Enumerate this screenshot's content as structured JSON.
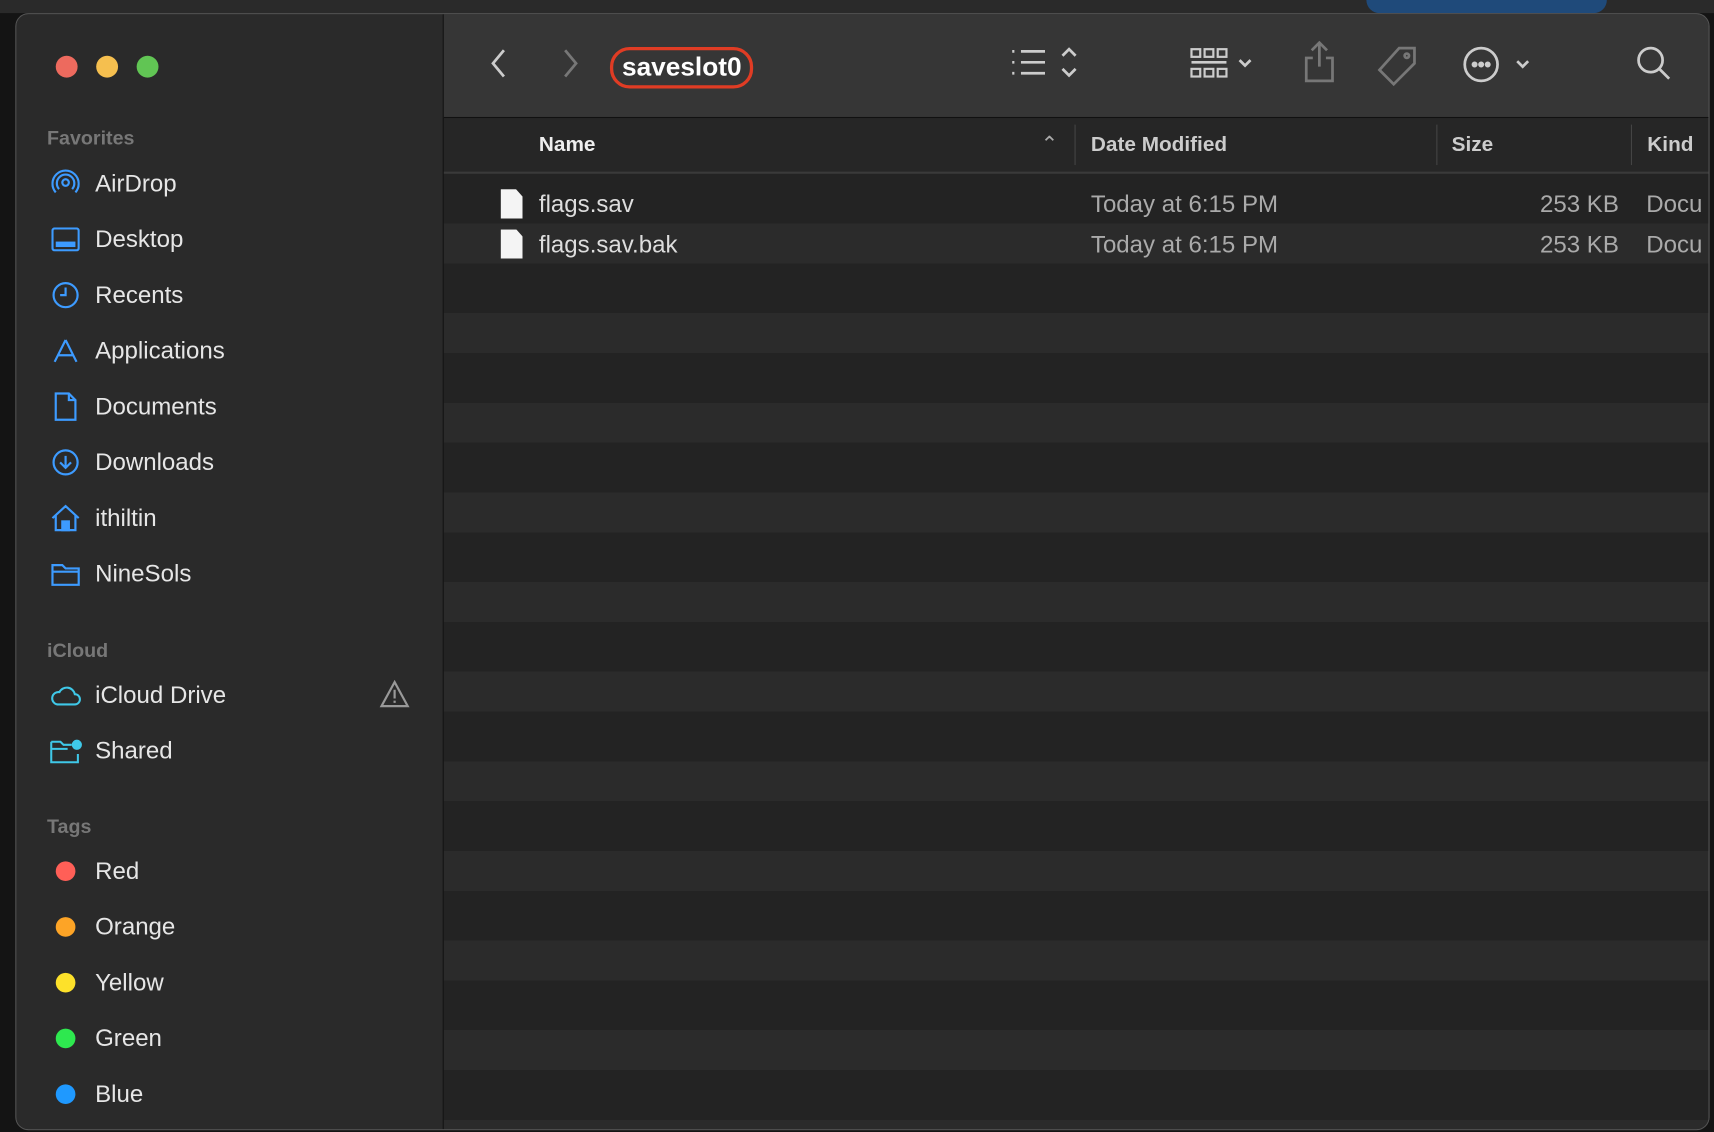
{
  "window": {
    "title": "saveslot0"
  },
  "sidebar": {
    "sections": [
      {
        "label": "Favorites",
        "items": [
          {
            "label": "AirDrop",
            "icon": "airdrop-icon"
          },
          {
            "label": "Desktop",
            "icon": "desktop-icon"
          },
          {
            "label": "Recents",
            "icon": "clock-icon"
          },
          {
            "label": "Applications",
            "icon": "applications-icon"
          },
          {
            "label": "Documents",
            "icon": "document-icon"
          },
          {
            "label": "Downloads",
            "icon": "download-icon"
          },
          {
            "label": "ithiltin",
            "icon": "home-icon"
          },
          {
            "label": "NineSols",
            "icon": "folder-icon"
          }
        ]
      },
      {
        "label": "iCloud",
        "items": [
          {
            "label": "iCloud Drive",
            "icon": "cloud-icon"
          },
          {
            "label": "Shared",
            "icon": "shared-folder-icon"
          }
        ]
      },
      {
        "label": "Tags",
        "items": [
          {
            "label": "Red",
            "color": "#ff5f57"
          },
          {
            "label": "Orange",
            "color": "#fda426"
          },
          {
            "label": "Yellow",
            "color": "#fde12a"
          },
          {
            "label": "Green",
            "color": "#2ee84f"
          },
          {
            "label": "Blue",
            "color": "#1f99ff"
          }
        ]
      }
    ]
  },
  "columns": {
    "name": "Name",
    "date": "Date Modified",
    "size": "Size",
    "kind": "Kind"
  },
  "files": [
    {
      "name": "flags.sav",
      "date": "Today at 6:15 PM",
      "size": "253 KB",
      "kind": "Docu"
    },
    {
      "name": "flags.sav.bak",
      "date": "Today at 6:15 PM",
      "size": "253 KB",
      "kind": "Docu"
    }
  ],
  "colors": {
    "highlight": "#e03c24",
    "accent": "#3d9bff"
  }
}
